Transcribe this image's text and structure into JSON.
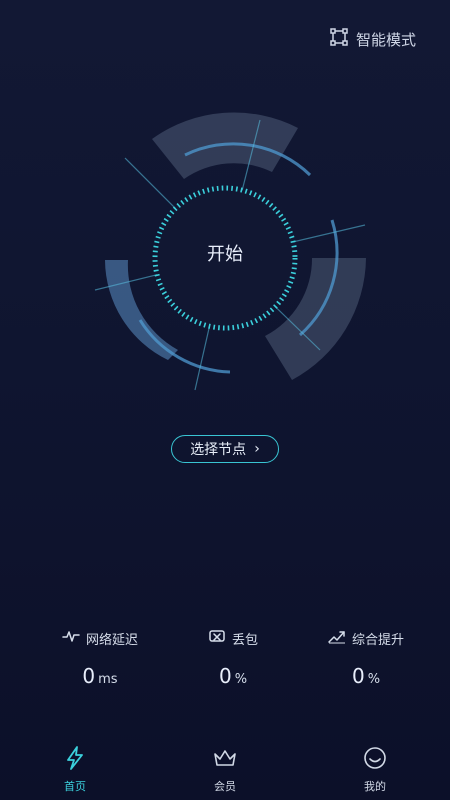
{
  "header": {
    "mode_label": "智能模式"
  },
  "radar": {
    "start_label": "开始"
  },
  "node": {
    "select_label": "选择节点",
    "chevron": "›"
  },
  "stats": [
    {
      "label": "网络延迟",
      "value": "0",
      "unit": "ms"
    },
    {
      "label": "丢包",
      "value": "0",
      "unit": "%"
    },
    {
      "label": "综合提升",
      "value": "0",
      "unit": "%"
    }
  ],
  "nav": [
    {
      "label": "首页",
      "icon": "lightning-icon",
      "active": true
    },
    {
      "label": "会员",
      "icon": "crown-icon",
      "active": false
    },
    {
      "label": "我的",
      "icon": "smile-icon",
      "active": false
    }
  ],
  "colors": {
    "accent": "#3bd0dc"
  }
}
